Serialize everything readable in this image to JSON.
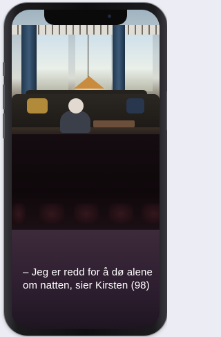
{
  "device": {
    "type": "phone"
  },
  "story": {
    "photo": {
      "icon": "photo-living-room"
    },
    "caption": "– Jeg er redd for å dø alene om natten, sier Kirsten (98)"
  },
  "colors": {
    "page_bg": "#ecedf4",
    "panel_bg": "#2d1e2f",
    "caption_text": "#ffffff"
  }
}
